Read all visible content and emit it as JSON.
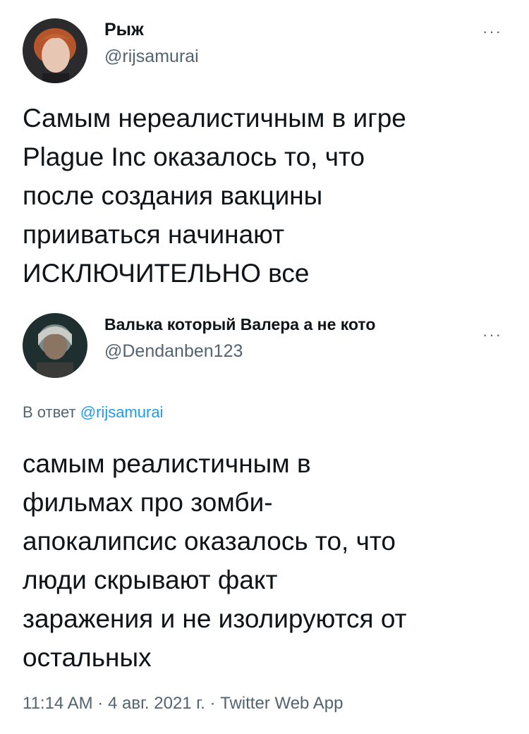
{
  "original_tweet": {
    "display_name": "Рыж",
    "handle": "@rijsamurai",
    "text": "Самым нереалистичным в игре\nPlague Inc оказалось то, что\nпосле создания вакцины\nприиваться начинают\nИСКЛЮЧИТЕЛЬНО все",
    "more_label": "···"
  },
  "reply_tweet": {
    "display_name": "Валька который Валера а не кото",
    "handle": "@Dendanben123",
    "more_label": "···",
    "reply_prefix": "В ответ",
    "reply_to": "@rijsamurai",
    "text": "самым реалистичным в\nфильмах про зомби-\nапокалипсис оказалось то, что\nлюди скрывают факт\nзаражения и не изолируются от\nостальных",
    "time": "11:14 AM",
    "date": "4 авг. 2021 г.",
    "source": "Twitter Web App",
    "separator": "·"
  },
  "colors": {
    "text_primary": "#0f1419",
    "text_secondary": "#536471",
    "link": "#1d9bf0",
    "background": "#ffffff"
  }
}
